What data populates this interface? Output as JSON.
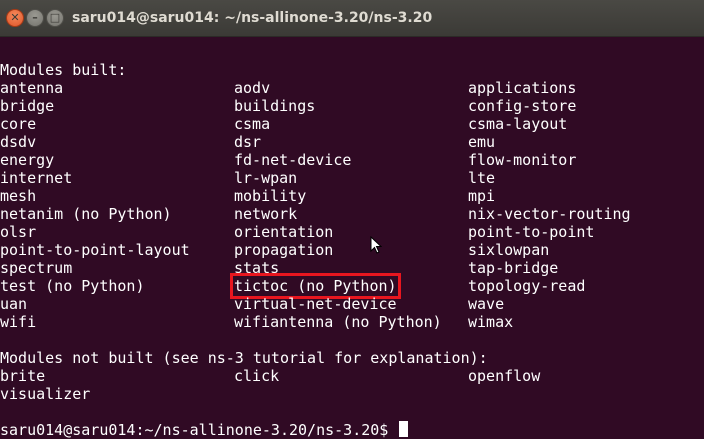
{
  "window": {
    "title": "saru014@saru014: ~/ns-allinone-3.20/ns-3.20",
    "close_glyph": "✕",
    "minimize_glyph": "–",
    "maximize_glyph": "□"
  },
  "terminal": {
    "built_header": "Modules built:",
    "built_rows": [
      [
        "antenna",
        "aodv",
        "applications"
      ],
      [
        "bridge",
        "buildings",
        "config-store"
      ],
      [
        "core",
        "csma",
        "csma-layout"
      ],
      [
        "dsdv",
        "dsr",
        "emu"
      ],
      [
        "energy",
        "fd-net-device",
        "flow-monitor"
      ],
      [
        "internet",
        "lr-wpan",
        "lte"
      ],
      [
        "mesh",
        "mobility",
        "mpi"
      ],
      [
        "netanim (no Python)",
        "network",
        "nix-vector-routing"
      ],
      [
        "olsr",
        "orientation",
        "point-to-point"
      ],
      [
        "point-to-point-layout",
        "propagation",
        "sixlowpan"
      ],
      [
        "spectrum",
        "stats",
        "tap-bridge"
      ],
      [
        "test (no Python)",
        "tictoc (no Python)",
        "topology-read"
      ],
      [
        "uan",
        "virtual-net-device",
        "wave"
      ],
      [
        "wifi",
        "wifiantenna (no Python)",
        "wimax"
      ]
    ],
    "not_built_header": "Modules not built (see ns-3 tutorial for explanation):",
    "not_built_rows": [
      [
        "brite",
        "click",
        "openflow"
      ],
      [
        "visualizer",
        "",
        ""
      ]
    ],
    "prompt": "saru014@saru014:~/ns-allinone-3.20/ns-3.20$ ",
    "highlighted_module": "tictoc (no Python)",
    "highlight_color": "#e8161f",
    "background_color": "#300a24"
  }
}
